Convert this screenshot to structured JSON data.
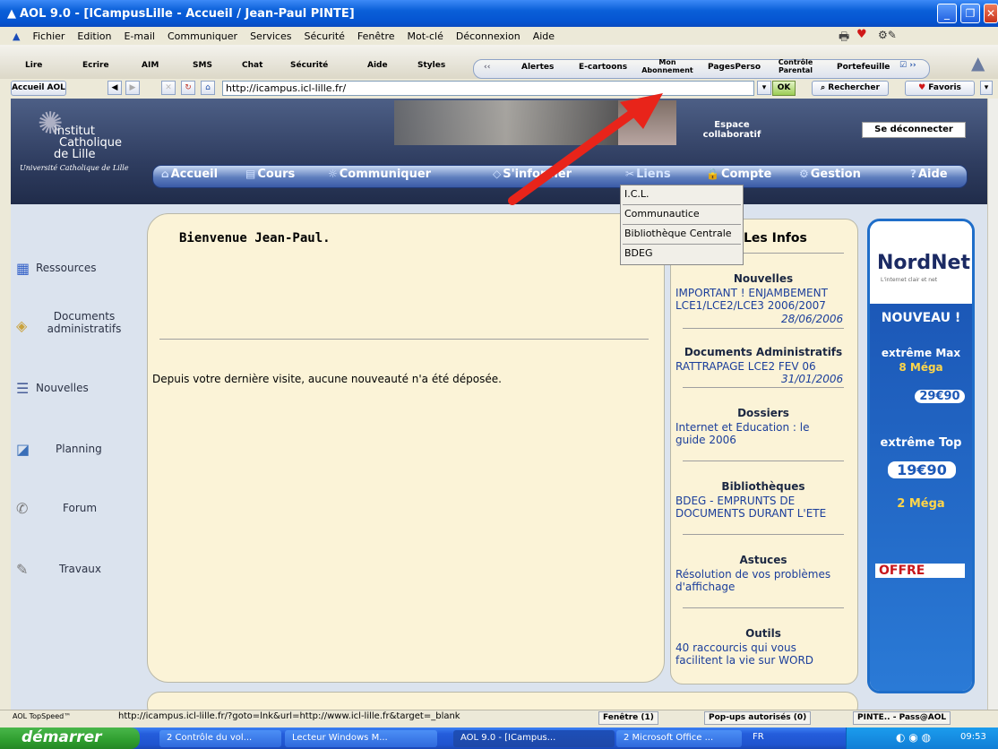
{
  "window": {
    "title": "AOL 9.0 - [ICampusLille - Accueil / Jean-Paul PINTE]"
  },
  "menu": [
    "Fichier",
    "Edition",
    "E-mail",
    "Communiquer",
    "Services",
    "Sécurité",
    "Fenêtre",
    "Mot-clé",
    "Déconnexion",
    "Aide"
  ],
  "toolbar": {
    "left_items": [
      "Lire",
      "Ecrire",
      "AIM",
      "SMS",
      "Chat",
      "Sécurité",
      "Aide",
      "Styles"
    ],
    "panel_items": [
      "Alertes",
      "E-cartoons",
      "Mon Abonnement",
      "PagesPerso",
      "Contrôle Parental",
      "Portefeuille"
    ]
  },
  "address": {
    "home_label": "Accueil AOL",
    "url": "http://icampus.icl-lille.fr/",
    "ok_label": "OK",
    "search_label": "Rechercher",
    "favorites_label": "Favoris"
  },
  "site": {
    "logo_lines": [
      "Institut",
      "Catholique",
      "de Lille"
    ],
    "logo_script": "Université Catholique de Lille",
    "espace": "Espace collaboratif",
    "logout": "Se déconnecter",
    "nav": [
      "Accueil",
      "Cours",
      "Communiquer",
      "S'informer",
      "Liens",
      "Compte",
      "Gestion",
      "Aide"
    ],
    "dropdown": [
      "I.C.L.",
      "Communautice",
      "Bibliothèque Centrale",
      "BDEG"
    ]
  },
  "sidebar": [
    "Ressources",
    "Documents administratifs",
    "Nouvelles",
    "Planning",
    "Forum",
    "Travaux"
  ],
  "main": {
    "welcome": "Bienvenue Jean-Paul.",
    "message": "Depuis votre dernière visite, aucune nouveauté n'a été déposée."
  },
  "infos": {
    "title": "Les Infos",
    "sections": [
      {
        "heading": "Nouvelles",
        "text": "IMPORTANT ! ENJAMBEMENT LCE1/LCE2/LCE3 2006/2007",
        "date": "28/06/2006"
      },
      {
        "heading": "Documents Administratifs",
        "text": "RATTRAPAGE LCE2 FEV 06",
        "date": "31/01/2006"
      },
      {
        "heading": "Dossiers",
        "text": "Internet et Education : le guide 2006",
        "date": ""
      },
      {
        "heading": "Bibliothèques",
        "text": "BDEG - EMPRUNTS DE DOCUMENTS DURANT L'ETE",
        "date": ""
      },
      {
        "heading": "Astuces",
        "text": "Résolution de vos problèmes d'affichage",
        "date": ""
      },
      {
        "heading": "Outils",
        "text": "40 raccourcis qui vous facilitent la vie sur WORD",
        "date": ""
      }
    ]
  },
  "ad": {
    "brand": "NordNet",
    "tagline": "L'internet clair et net",
    "nouveau": "NOUVEAU !",
    "max": "extrême Max",
    "max_speed": "8 Méga",
    "price1": "29€90",
    "top": "extrême Top",
    "price2": "19€90",
    "mega2": "2 Méga",
    "offre": "OFFRE"
  },
  "status": {
    "speed": "AOL TopSpeed™",
    "url": "http://icampus.icl-lille.fr/?goto=lnk&url=http://www.icl-lille.fr&target=_blank",
    "window": "Fenêtre (1)",
    "popups": "Pop-ups autorisés (0)",
    "pass": "PINTE.. - Pass@AOL"
  },
  "taskbar": {
    "start": "démarrer",
    "tasks": [
      "2 Contrôle du vol...",
      "Lecteur Windows M...",
      "AOL 9.0 - [ICampus...",
      "2 Microsoft Office ..."
    ],
    "lang": "FR",
    "clock": "09:53"
  },
  "colors": {
    "accent": "#1f6ec9",
    "panel": "#fbf3d7",
    "arrow": "#e8241a"
  }
}
